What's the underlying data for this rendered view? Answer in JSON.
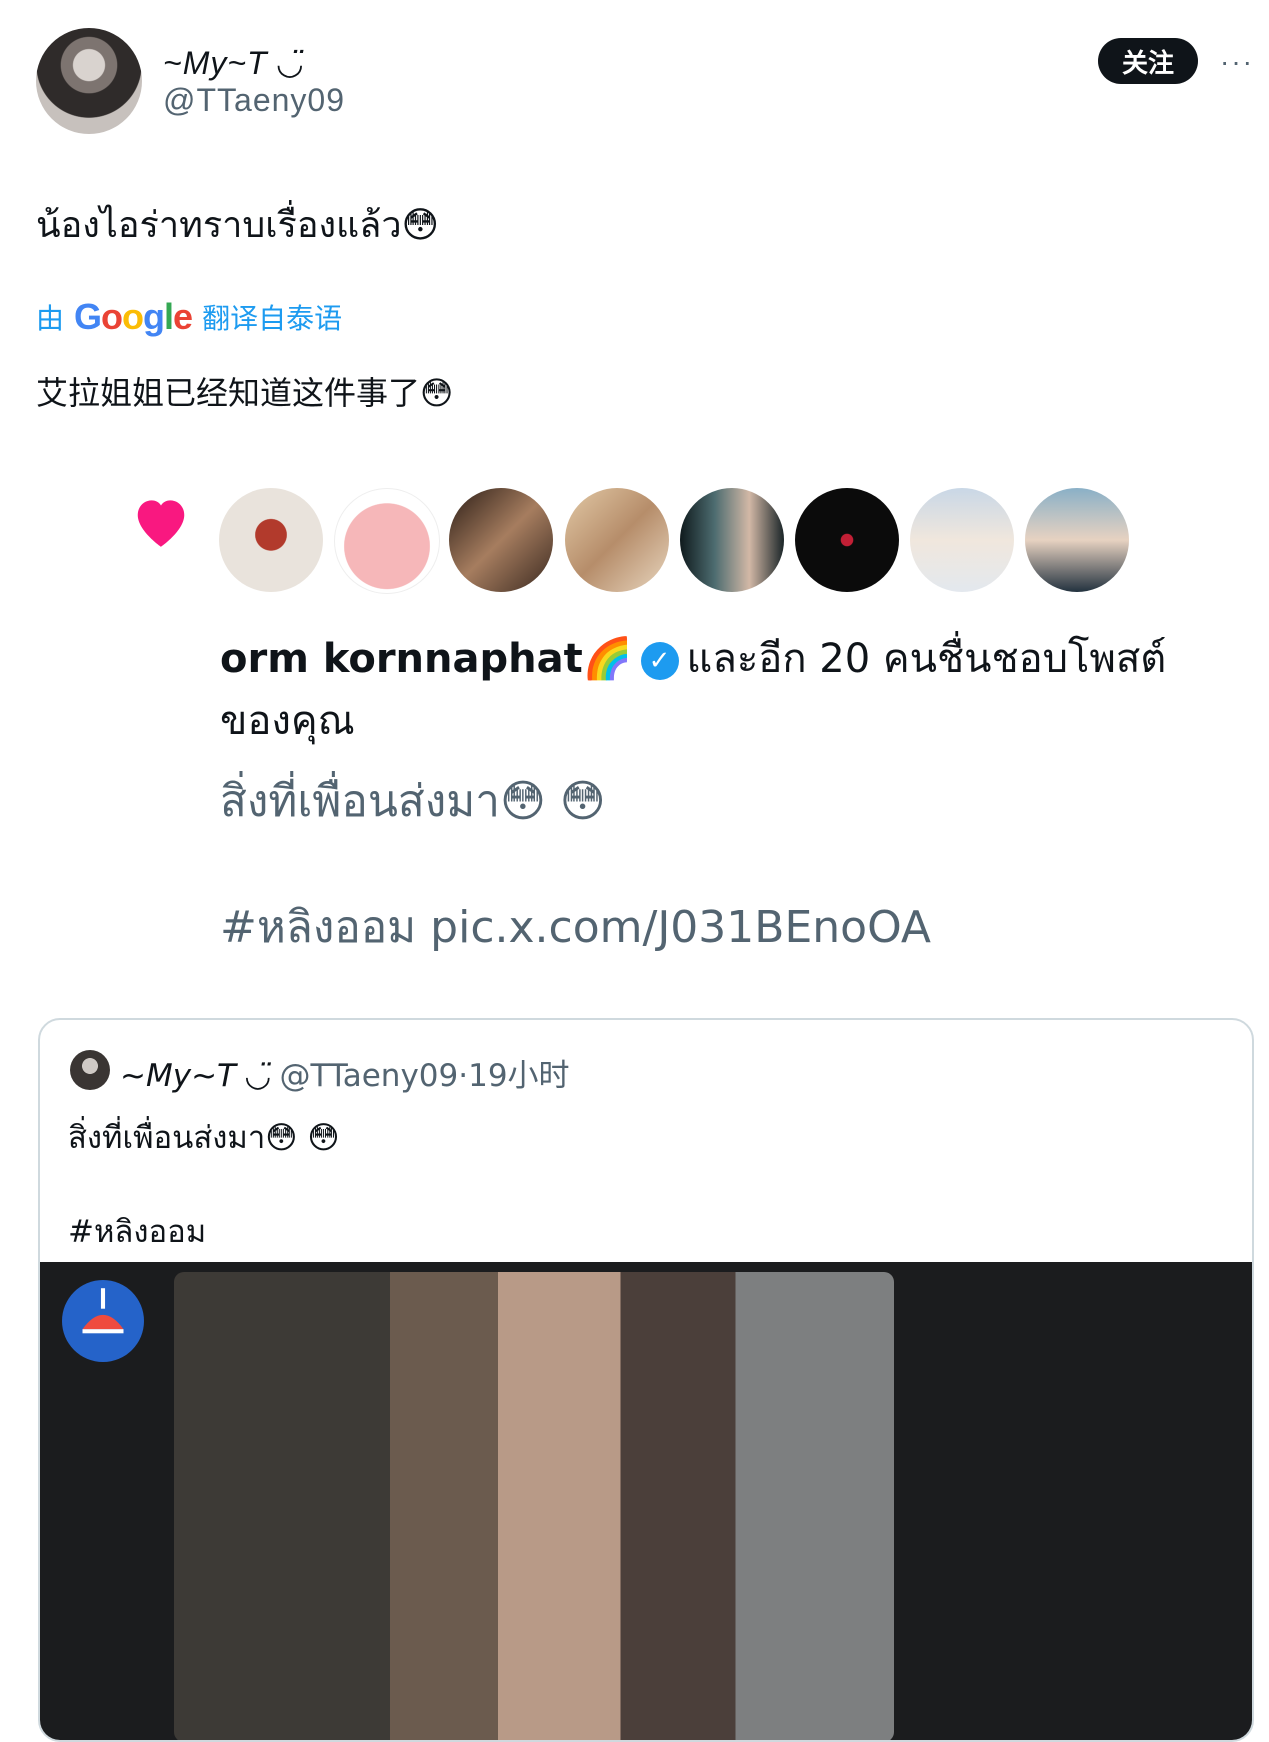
{
  "tweet": {
    "display_name": "~My~T ◡̈",
    "handle": "@TTaeny09",
    "follow_label": "关注",
    "more_label": "···",
    "text": "น้องไอร่าทราบเรื่องแล้ว😳",
    "translate_prefix": "由",
    "translate_brand": "Google",
    "translate_suffix": "翻译自泰语",
    "translated_text": "艾拉姐姐已经知道这件事了😳"
  },
  "likes": {
    "liker_name": "orm kornnaphat🌈",
    "verified_mark": "✓",
    "liker_suffix": "และอีก 20 คนชื่นชอบโพสต์ของคุณ",
    "liked_post_text": "สิ่งที่เพื่อนส่งมา😳 😳",
    "liked_post_tag": "#หลิงออม pic.x.com/J031BEnoOA"
  },
  "quote": {
    "name": "~My~T ◡̈",
    "handle_time": "@TTaeny09·19小时",
    "text": "สิ่งที่เพื่อนส่งมา😳 😳",
    "tag": "#หลิงออม"
  },
  "colors": {
    "accent": "#1d9bf0",
    "heart": "#f91880",
    "text_primary": "#0f1419",
    "text_secondary": "#536471"
  }
}
